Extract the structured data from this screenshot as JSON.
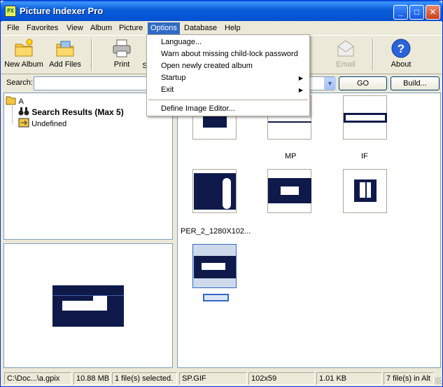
{
  "window": {
    "title": "Picture Indexer Pro",
    "app_icon_text": "PX",
    "controls": {
      "minimize": "_",
      "maximize": "□",
      "close": "✕"
    }
  },
  "menubar": {
    "items": [
      "File",
      "Favorites",
      "View",
      "Album",
      "Picture",
      "Options",
      "Database",
      "Help"
    ],
    "active": "Options"
  },
  "options_menu": {
    "items": [
      {
        "label": "Language..."
      },
      {
        "label": "Warn about missing child-lock password"
      },
      {
        "label": "Open newly created album"
      },
      {
        "label": "Startup",
        "arrow": "▶"
      },
      {
        "label": "Exit",
        "arrow": "▶"
      },
      {
        "label": "Define Image Editor..."
      }
    ]
  },
  "toolbar": {
    "new_album": "New Album",
    "add_files": "Add Files",
    "print": "Print",
    "s_partial": "S",
    "email": "Email",
    "about": "About"
  },
  "search": {
    "label": "Search:",
    "value": "",
    "go": "GO",
    "build": "Build...",
    "dropdown_arrow": "▼"
  },
  "tree": {
    "root": "A",
    "search_results": "Search Results (Max 5)",
    "undefined": "Undefined"
  },
  "gallery": {
    "captions": {
      "row1_c2": "MP",
      "row1_c3": "IF",
      "row2_c1": "PER_2_1280X102..."
    }
  },
  "statusbar": {
    "path": "C:\\Doc...\\a.gpix",
    "db_size": "10.88 MB",
    "selection": "1 file(s) selected.",
    "filename": "SP.GIF",
    "dimensions": "102x59",
    "file_size": "1.01 KB",
    "count": "7 file(s) in Alt"
  },
  "colors": {
    "title_bar": "#0a5fd8",
    "menu_highlight": "#316ac5",
    "image_blue": "#0f1a4a"
  }
}
